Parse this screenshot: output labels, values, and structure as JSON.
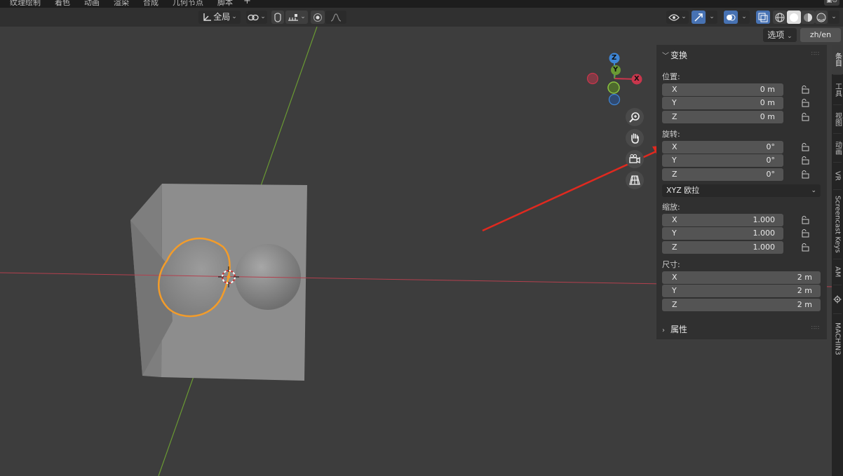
{
  "workspace_tabs": [
    "纹理绘制",
    "着色",
    "动画",
    "渲染",
    "合成",
    "几何节点",
    "脚本"
  ],
  "add_tab": "+",
  "header": {
    "transform_orientation": "全局",
    "options_label": "选项",
    "language_label": "zh/en"
  },
  "gizmo": {
    "z": "Z",
    "y": "Y",
    "x": "X"
  },
  "npanel": {
    "transform_title": "变换",
    "location_label": "位置:",
    "location": [
      {
        "axis": "X",
        "value": "0 m"
      },
      {
        "axis": "Y",
        "value": "0 m"
      },
      {
        "axis": "Z",
        "value": "0 m"
      }
    ],
    "rotation_label": "旋转:",
    "rotation": [
      {
        "axis": "X",
        "value": "0°"
      },
      {
        "axis": "Y",
        "value": "0°"
      },
      {
        "axis": "Z",
        "value": "0°"
      }
    ],
    "rotation_mode": "XYZ 欧拉",
    "scale_label": "缩放:",
    "scale": [
      {
        "axis": "X",
        "value": "1.000"
      },
      {
        "axis": "Y",
        "value": "1.000"
      },
      {
        "axis": "Z",
        "value": "1.000"
      }
    ],
    "dimensions_label": "尺寸:",
    "dimensions": [
      {
        "axis": "X",
        "value": "2 m"
      },
      {
        "axis": "Y",
        "value": "2 m"
      },
      {
        "axis": "Z",
        "value": "2 m"
      }
    ],
    "properties_title": "属性"
  },
  "side_tabs": [
    "条目",
    "工具",
    "视图",
    "动画",
    "VR",
    "Screencast Keys",
    "AM",
    "MACHIN3"
  ],
  "colors": {
    "x_axis": "#c9364c",
    "y_axis": "#6a9a33",
    "z_axis": "#3e86d6",
    "selection_outline": "#f39c2a",
    "annotation_arrow": "#e0291f",
    "active_button": "#4772b3"
  }
}
